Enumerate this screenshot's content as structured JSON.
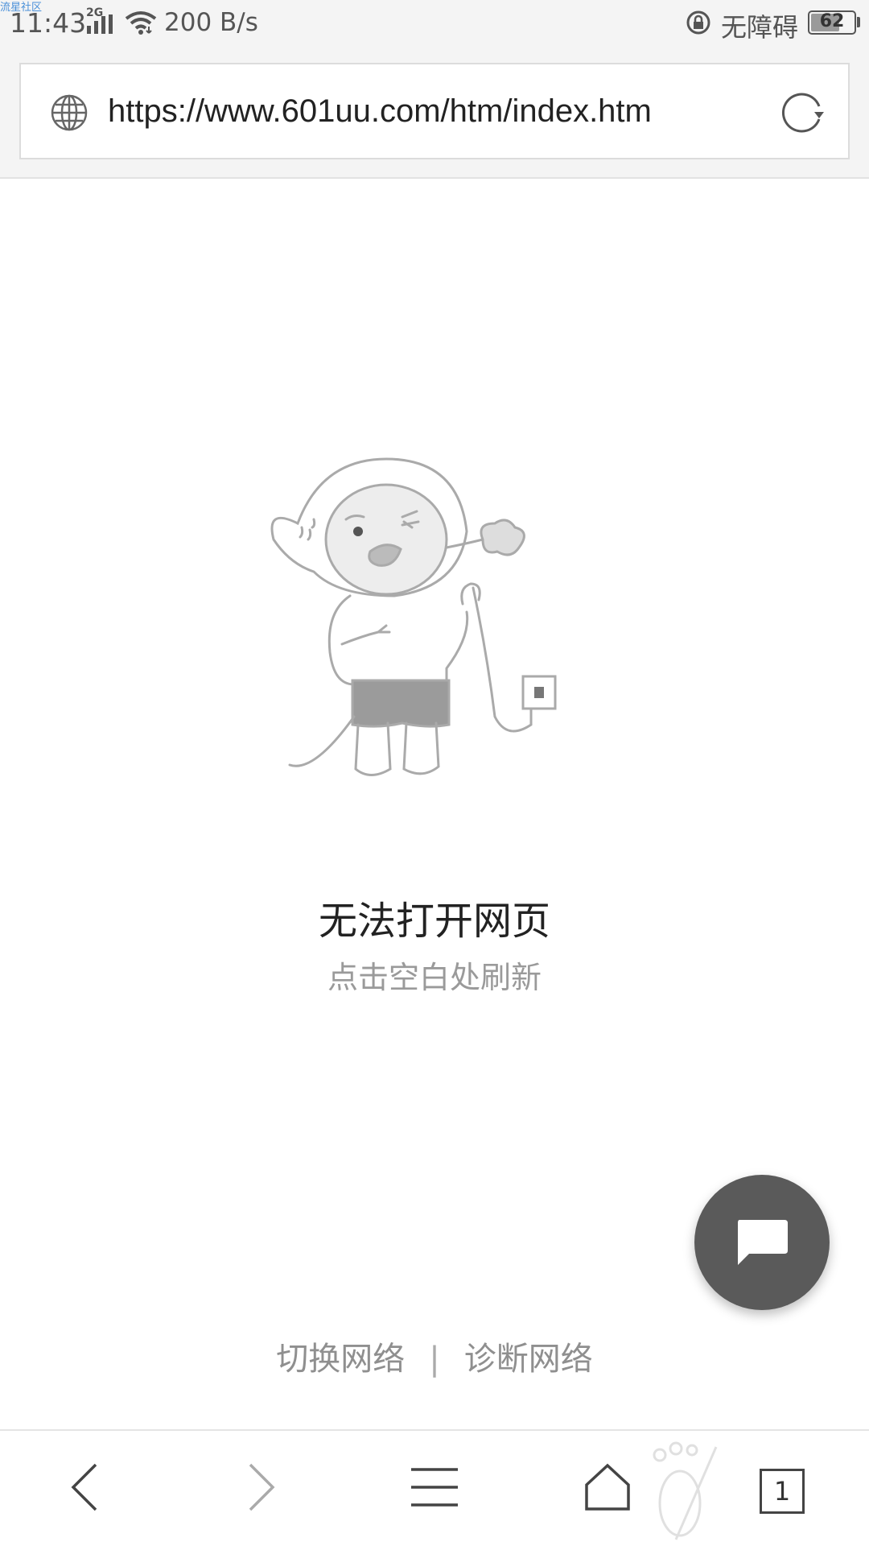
{
  "status_bar": {
    "watermark": "流星社区",
    "time": "11:43",
    "network_type": "2G",
    "net_speed": "200 B/s",
    "accessibility_label": "无障碍",
    "battery_level": "62",
    "battery_fraction": 0.62
  },
  "address_bar": {
    "url": "https://www.601uu.com/htm/index.htm"
  },
  "error": {
    "title": "无法打开网页",
    "hint": "点击空白处刷新"
  },
  "network_links": {
    "switch_network": "切换网络",
    "separator": "|",
    "diagnose_network": "诊断网络"
  },
  "toolbar": {
    "tab_count": "1"
  },
  "colors": {
    "status_bg": "#f4f4f4",
    "fab_bg": "#5a5a5a",
    "hint_text": "#9a9a9a"
  }
}
